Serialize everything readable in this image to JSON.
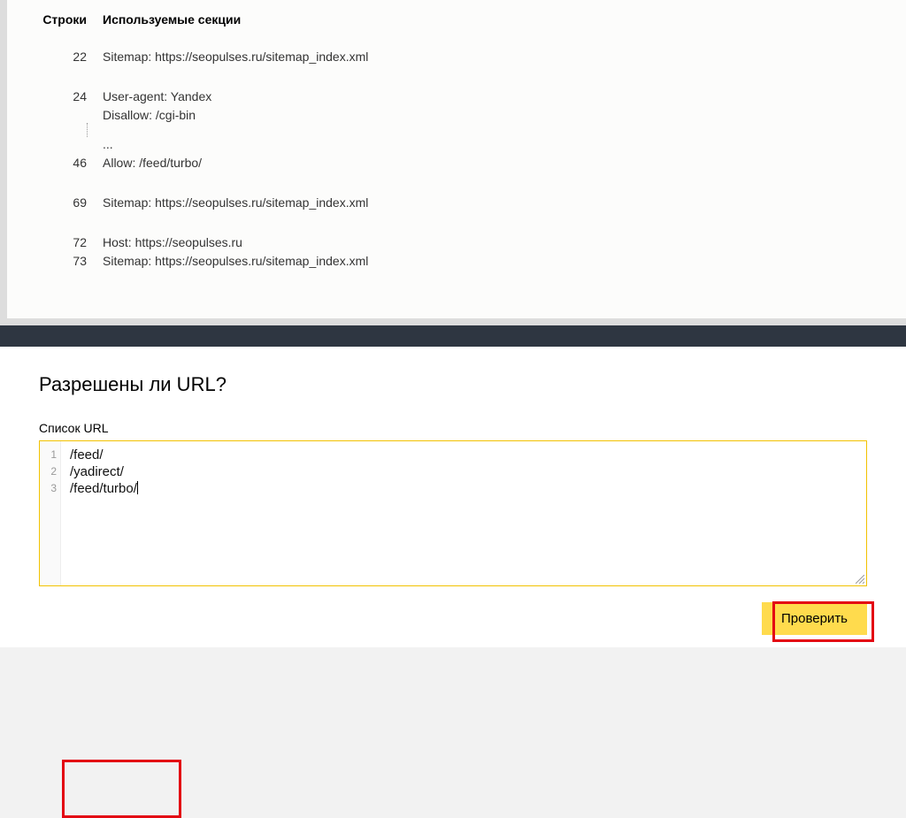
{
  "headers": {
    "lines": "Строки",
    "content": "Используемые секции"
  },
  "robots_rows": [
    {
      "block": [
        {
          "ln": "22",
          "txt": "Sitemap: https://seopulses.ru/sitemap_index.xml"
        }
      ]
    },
    {
      "block": [
        {
          "ln": "24",
          "txt": "User-agent: Yandex"
        },
        {
          "ln": "",
          "txt": "Disallow: /cgi-bin"
        },
        {
          "gap": true,
          "txt": "..."
        },
        {
          "ln": "46",
          "txt": "Allow: /feed/turbo/"
        }
      ]
    },
    {
      "block": [
        {
          "ln": "69",
          "txt": "Sitemap: https://seopulses.ru/sitemap_index.xml"
        }
      ]
    },
    {
      "block": [
        {
          "ln": "72",
          "txt": "Host: https://seopulses.ru"
        },
        {
          "ln": "73",
          "txt": "Sitemap: https://seopulses.ru/sitemap_index.xml"
        }
      ]
    }
  ],
  "urlcheck": {
    "heading": "Разрешены ли URL?",
    "label": "Список URL",
    "lines": [
      "/feed/",
      "/yadirect/",
      "/feed/turbo/"
    ],
    "gutter": [
      "1",
      "2",
      "3"
    ],
    "button": "Проверить"
  }
}
